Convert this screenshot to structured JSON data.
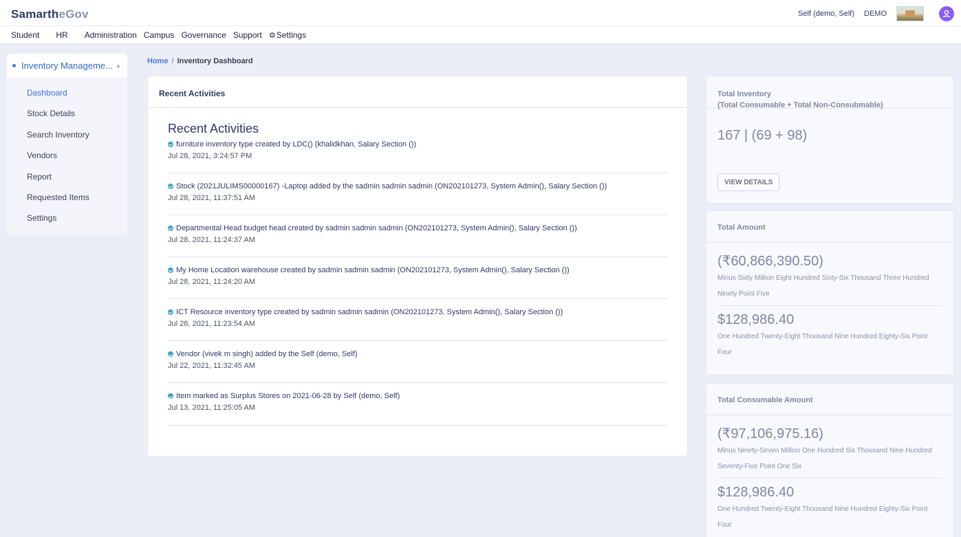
{
  "header": {
    "brand_primary": "Samarth",
    "brand_secondary": "eGov",
    "user_name": "Self (demo, Self)",
    "user_role": "DEMO"
  },
  "nav": {
    "items": [
      "Student",
      "HR",
      "Administration",
      "Campus",
      "Governance",
      "Support",
      "Settings"
    ]
  },
  "sidebar": {
    "module_title": "Inventory Manageme...",
    "items": [
      "Dashboard",
      "Stock Details",
      "Search Inventory",
      "Vendors",
      "Report",
      "Requested Items",
      "Settings"
    ],
    "active": "Dashboard"
  },
  "breadcrumb": {
    "home": "Home",
    "separator": "/",
    "current": "Inventory Dashboard"
  },
  "activities": {
    "card_title": "Recent Activities",
    "section_title": "Recent Activities",
    "items": [
      {
        "text": "furniture inventory type created by LDC() (khalidkhan, Salary Section ())",
        "time": "Jul 28, 2021, 3:24:57 PM"
      },
      {
        "text": "Stock (2021JULIMS00000167) -Laptop added by the sadmin sadmin sadmin (ON202101273, System Admin(), Salary Section ())",
        "time": "Jul 28, 2021, 11:37:51 AM"
      },
      {
        "text": "Departmental Head budget head created by sadmin sadmin sadmin (ON202101273, System Admin(), Salary Section ())",
        "time": "Jul 28, 2021, 11:24:37 AM"
      },
      {
        "text": "My Home Location warehouse created by sadmin sadmin sadmin (ON202101273, System Admin(), Salary Section ())",
        "time": "Jul 28, 2021, 11:24:20 AM"
      },
      {
        "text": "ICT Resource inventory type created by sadmin sadmin sadmin (ON202101273, System Admin(), Salary Section ())",
        "time": "Jul 28, 2021, 11:23:54 AM"
      },
      {
        "text": "Vendor (vivek m singh) added by the Self (demo, Self)",
        "time": "Jul 22, 2021, 11:32:45 AM"
      },
      {
        "text": "Item marked as Surplus Stores on 2021-06-28 by Self (demo, Self)",
        "time": "Jul 13, 2021, 11:25:05 AM"
      }
    ]
  },
  "total_inventory": {
    "title_line1": "Total Inventory",
    "title_line2": "(Total Consumable + Total Non-Consubmable)",
    "value": "167 | (69 + 98)",
    "button": "VIEW DETAILS"
  },
  "total_amount": {
    "title": "Total Amount",
    "amount1": "(₹60,866,390.50)",
    "words1": "Minus Sixty Million Eight Hundred Sixty-Six Thousand Three Hundred Ninety Point Five",
    "amount2": "$128,986.40",
    "words2": "One Hundred Twenty-Eight Thousand Nine Hundred Eighty-Six Point Four"
  },
  "total_consumable": {
    "title": "Total Consumable Amount",
    "amount1": "(₹97,106,975.16)",
    "words1": "Minus Ninety-Seven Million One Hundred Six Thousand Nine Hundred Seventy-Five Point One Six",
    "amount2": "$128,986.40",
    "words2": "One Hundred Twenty-Eight Thousand Nine Hundred Eighty-Six Point Four"
  },
  "colors": {
    "accent": "#3d71d9",
    "check": "#3a9fc7",
    "avatar": "#8a5cf6"
  }
}
